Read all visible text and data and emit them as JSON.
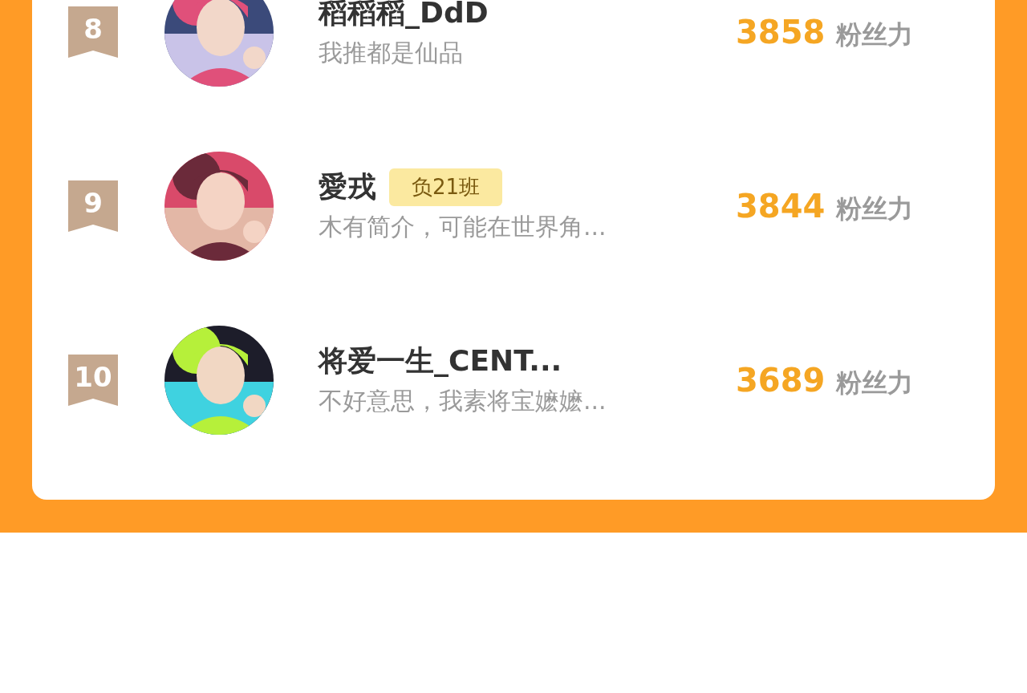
{
  "ranking": [
    {
      "rank": "8",
      "name": "稻稻稻_DdD",
      "subtitle": "我推都是仙品",
      "score": "3858",
      "score_label": "粉丝力"
    },
    {
      "rank": "9",
      "name": "愛戎",
      "tag": "负21班",
      "subtitle": "木有简介，可能在世界角...",
      "score": "3844",
      "score_label": "粉丝力"
    },
    {
      "rank": "10",
      "name": "将爱一生_CENT...",
      "subtitle": "不好意思，我素将宝嬷嬷...",
      "score": "3689",
      "score_label": "粉丝力"
    }
  ]
}
